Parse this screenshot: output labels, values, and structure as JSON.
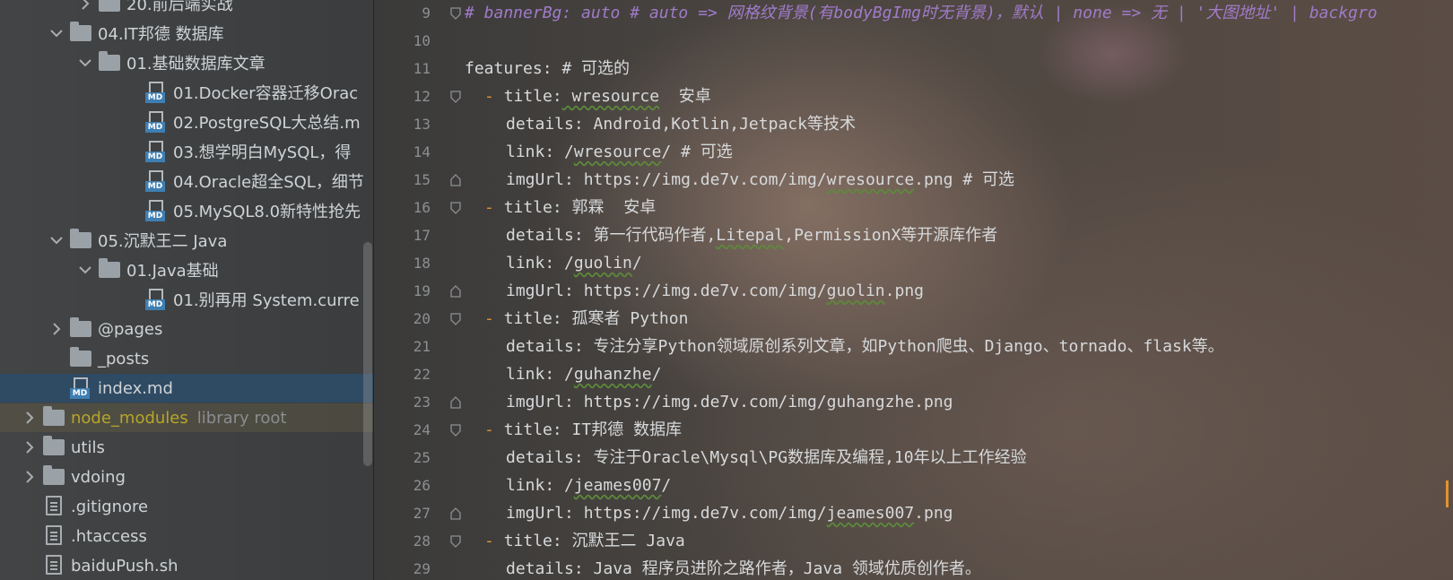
{
  "project_tree": {
    "items": [
      {
        "label": "20.前后端实战",
        "arrow": "right",
        "icon": "folder-icon"
      },
      {
        "label": "04.IT邦德 数据库",
        "arrow": "down",
        "icon": "folder-icon"
      },
      {
        "label": "01.基础数据库文章",
        "arrow": "down",
        "icon": "folder-icon"
      },
      {
        "label": "01.Docker容器迁移Orac",
        "arrow": "",
        "icon": "markdown-file-icon"
      },
      {
        "label": "02.PostgreSQL大总结.m",
        "arrow": "",
        "icon": "markdown-file-icon"
      },
      {
        "label": "03.想学明白MySQL，得",
        "arrow": "",
        "icon": "markdown-file-icon"
      },
      {
        "label": "04.Oracle超全SQL，细节",
        "arrow": "",
        "icon": "markdown-file-icon"
      },
      {
        "label": "05.MySQL8.0新特性抢先",
        "arrow": "",
        "icon": "markdown-file-icon"
      },
      {
        "label": "05.沉默王二 Java",
        "arrow": "down",
        "icon": "folder-icon"
      },
      {
        "label": "01.Java基础",
        "arrow": "down",
        "icon": "folder-icon"
      },
      {
        "label": "01.别再用 System.curre",
        "arrow": "",
        "icon": "markdown-file-icon"
      },
      {
        "label": "@pages",
        "arrow": "right",
        "icon": "folder-icon"
      },
      {
        "label": "_posts",
        "arrow": "",
        "icon": "folder-icon"
      },
      {
        "label": "index.md",
        "arrow": "",
        "icon": "markdown-file-icon"
      },
      {
        "label": "node_modules",
        "suffix": "library root",
        "arrow": "right",
        "icon": "folder-icon"
      },
      {
        "label": "utils",
        "arrow": "right",
        "icon": "folder-icon"
      },
      {
        "label": "vdoing",
        "arrow": "right",
        "icon": "folder-icon"
      },
      {
        "label": ".gitignore",
        "arrow": "",
        "icon": "gitignore-file-icon"
      },
      {
        "label": ".htaccess",
        "arrow": "",
        "icon": "text-file-icon"
      },
      {
        "label": "baiduPush.sh",
        "arrow": "",
        "icon": "shell-script-icon"
      }
    ]
  },
  "editor": {
    "line_numbers": [
      "9",
      "10",
      "11",
      "12",
      "13",
      "14",
      "15",
      "16",
      "17",
      "18",
      "19",
      "20",
      "21",
      "22",
      "23",
      "24",
      "25",
      "26",
      "27",
      "28",
      "29"
    ],
    "lines": [
      {
        "comment": "# bannerBg: auto # auto => 网格纹背景(有bodyBgImg时无背景)，默认 | none => 无 | '大图地址' | backgro"
      },
      {},
      {
        "key": "features:",
        "rest": " # 可选的"
      },
      {
        "dash": "- ",
        "key": "title:",
        "value": " wresource",
        "rest": "  安卓"
      },
      {
        "key": "details:",
        "rest": " Android,Kotlin,Jetpack等技术"
      },
      {
        "key": "link:",
        "rest": " /wresource/ # 可选"
      },
      {
        "key": "imgUrl:",
        "rest": " https://img.de7v.com/img/wresource.png # 可选"
      },
      {
        "dash": "- ",
        "key": "title:",
        "rest": " 郭霖  安卓"
      },
      {
        "key": "details:",
        "rest": " 第一行代码作者,Litepal,PermissionX等开源库作者"
      },
      {
        "key": "link:",
        "rest": " /guolin/"
      },
      {
        "key": "imgUrl:",
        "rest": " https://img.de7v.com/img/guolin.png"
      },
      {
        "dash": "- ",
        "key": "title:",
        "rest": " 孤寒者 Python"
      },
      {
        "key": "details:",
        "rest": " 专注分享Python领域原创系列文章，如Python爬虫、Django、tornado、flask等。"
      },
      {
        "key": "link:",
        "rest": " /guhanzhe/"
      },
      {
        "key": "imgUrl:",
        "rest": " https://img.de7v.com/img/guhangzhe.png"
      },
      {
        "dash": "- ",
        "key": "title:",
        "rest": " IT邦德 数据库"
      },
      {
        "key": "details:",
        "rest": " 专注于Oracle\\Mysql\\PG数据库及编程,10年以上工作经验"
      },
      {
        "key": "link:",
        "rest": " /jeames007/"
      },
      {
        "key": "imgUrl:",
        "rest": " https://img.de7v.com/img/jeames007.png"
      },
      {
        "dash": "- ",
        "key": "title:",
        "rest": " 沉默王二 Java"
      },
      {
        "key": "details:",
        "rest": " Java 程序员进阶之路作者，Java 领域优质创作者。"
      }
    ]
  }
}
